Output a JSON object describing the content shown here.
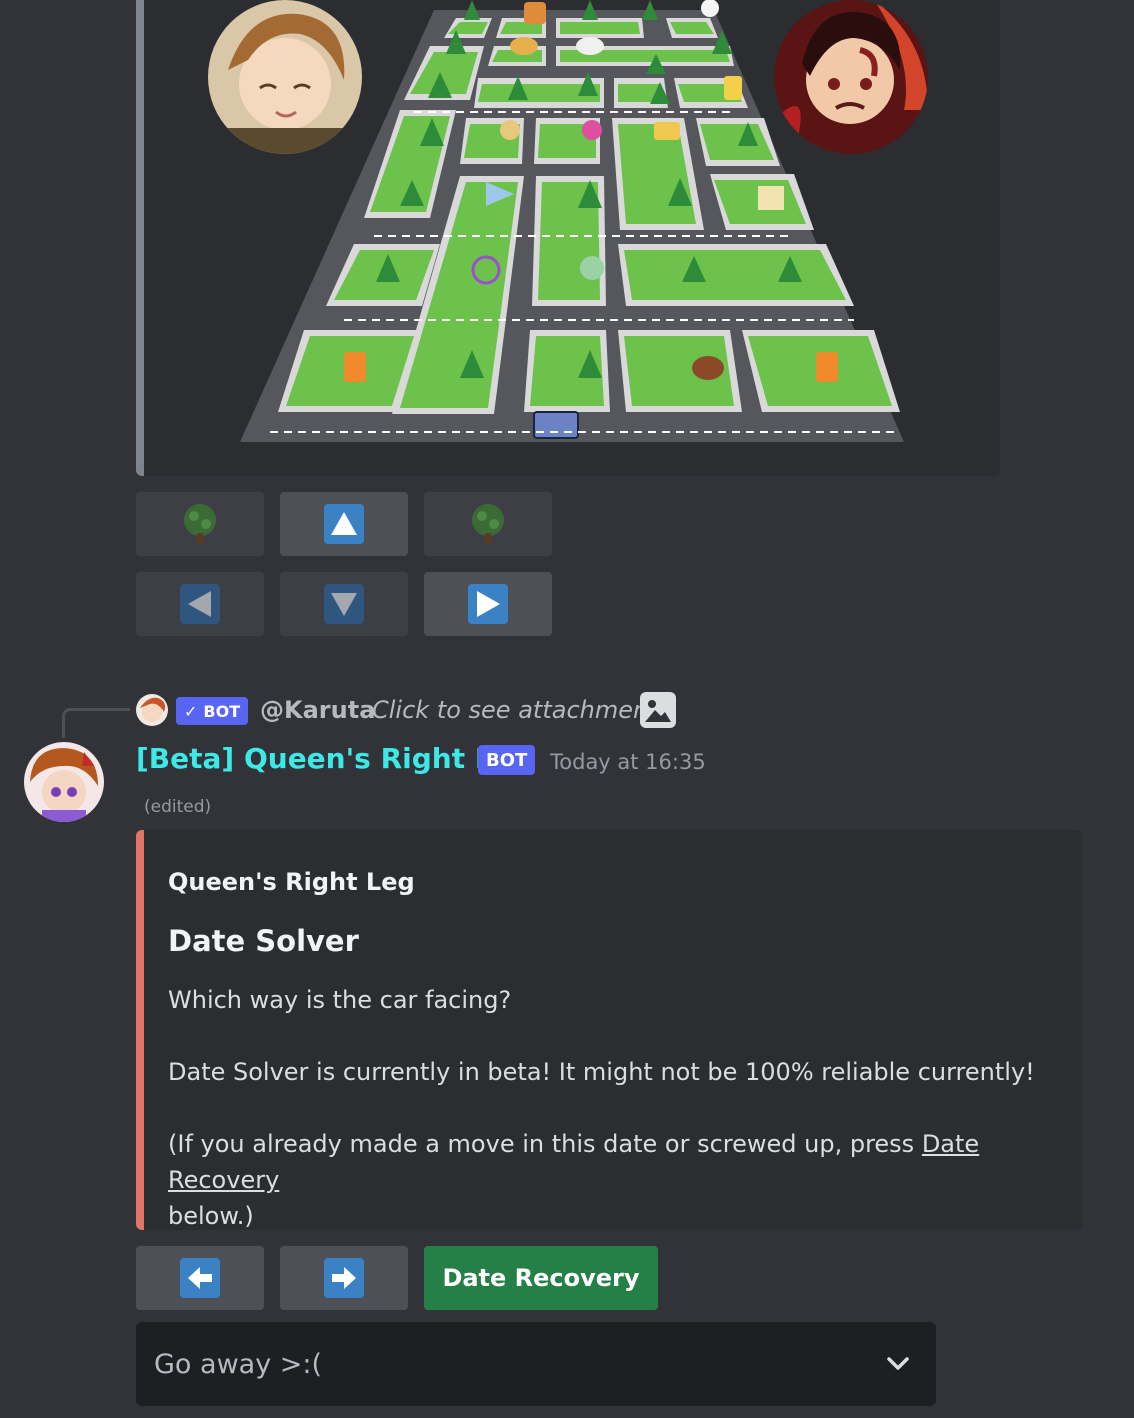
{
  "game_buttons": {
    "row1": [
      "tree-icon",
      "up-arrow-icon",
      "tree-icon"
    ],
    "row2": [
      "left-arrow-icon",
      "down-arrow-icon",
      "right-arrow-icon"
    ]
  },
  "reply": {
    "bot_tag": "BOT",
    "name": "@Karuta",
    "text": "Click to see attachment"
  },
  "message": {
    "username": "[Beta] Queen's Right Leg",
    "bot_tag": "BOT",
    "timestamp": "Today at 16:35",
    "edited": "(edited)"
  },
  "embed": {
    "accent_color": "#e07466",
    "author": "Queen's Right Leg",
    "title": "Date Solver",
    "line1": "Which way is the car facing?",
    "line2": "Date Solver is currently in beta! It might not be 100% reliable currently!",
    "line3_prefix": "(If you already made a move in this date or screwed up, press ",
    "line3_link": "Date Recovery",
    "line3_suffix": "below.)"
  },
  "action_buttons": {
    "left_icon": "left-arrow-icon",
    "right_icon": "right-arrow-icon",
    "recovery_label": "Date Recovery"
  },
  "select": {
    "value": "Go away >:("
  }
}
